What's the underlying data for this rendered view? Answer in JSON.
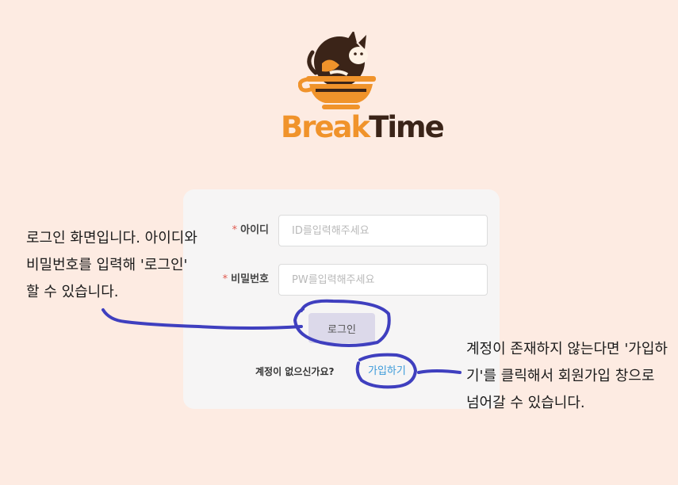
{
  "brand": {
    "part1": "Break",
    "part2": "Time"
  },
  "form": {
    "id_required_mark": "*",
    "id_label": "아이디",
    "id_placeholder": "ID를입력해주세요",
    "pw_required_mark": "*",
    "pw_label": "비밀번호",
    "pw_placeholder": "PW를입력해주세요",
    "login_label": "로그인",
    "signup_question": "계정이 없으신가요?",
    "signup_link": "가입하기"
  },
  "notes": {
    "left": "로그인 화면입니다. 아이디와 비밀번호를 입력해 '로그인' 할 수 있습니다.",
    "right": "계정이 존재하지 않는다면 '가입하기'를 클릭해서 회원가입 창으로 넘어갈 수 있습니다."
  },
  "colors": {
    "background": "#fdebe2",
    "brand_orange": "#f0932b",
    "brand_brown": "#3b2418",
    "ink": "#3f3fbf"
  }
}
